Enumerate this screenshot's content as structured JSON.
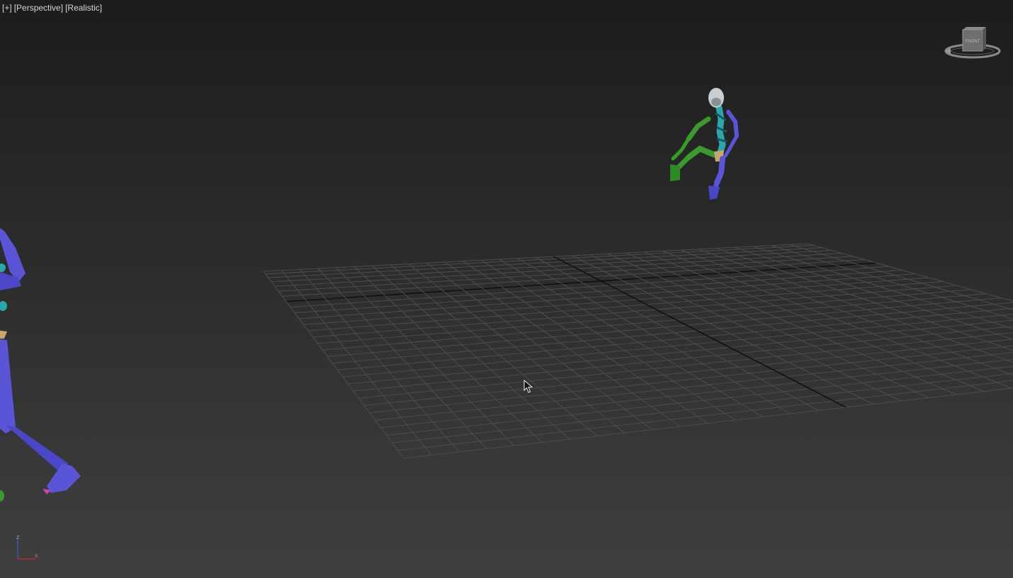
{
  "viewport": {
    "labels": {
      "plus": "[+]",
      "view": "[Perspective]",
      "shading": "[Realistic]"
    }
  },
  "viewcube": {
    "face_label": "FRONT"
  },
  "axis_tripod": {
    "x_label": "x",
    "z_label": "z",
    "x_color": "#c83232",
    "z_color": "#3c5ad2"
  },
  "colors": {
    "grid_line": "#4d4d4d",
    "grid_axis": "#0d0d0d",
    "skeleton_blue": "#5a55d6",
    "skeleton_green": "#3a9a2e",
    "skeleton_cyan": "#2aa7ad",
    "skeleton_head": "#c8cdd2"
  },
  "icons": [
    "viewcube-icon",
    "axis-tripod-icon",
    "mouse-cursor-icon"
  ]
}
